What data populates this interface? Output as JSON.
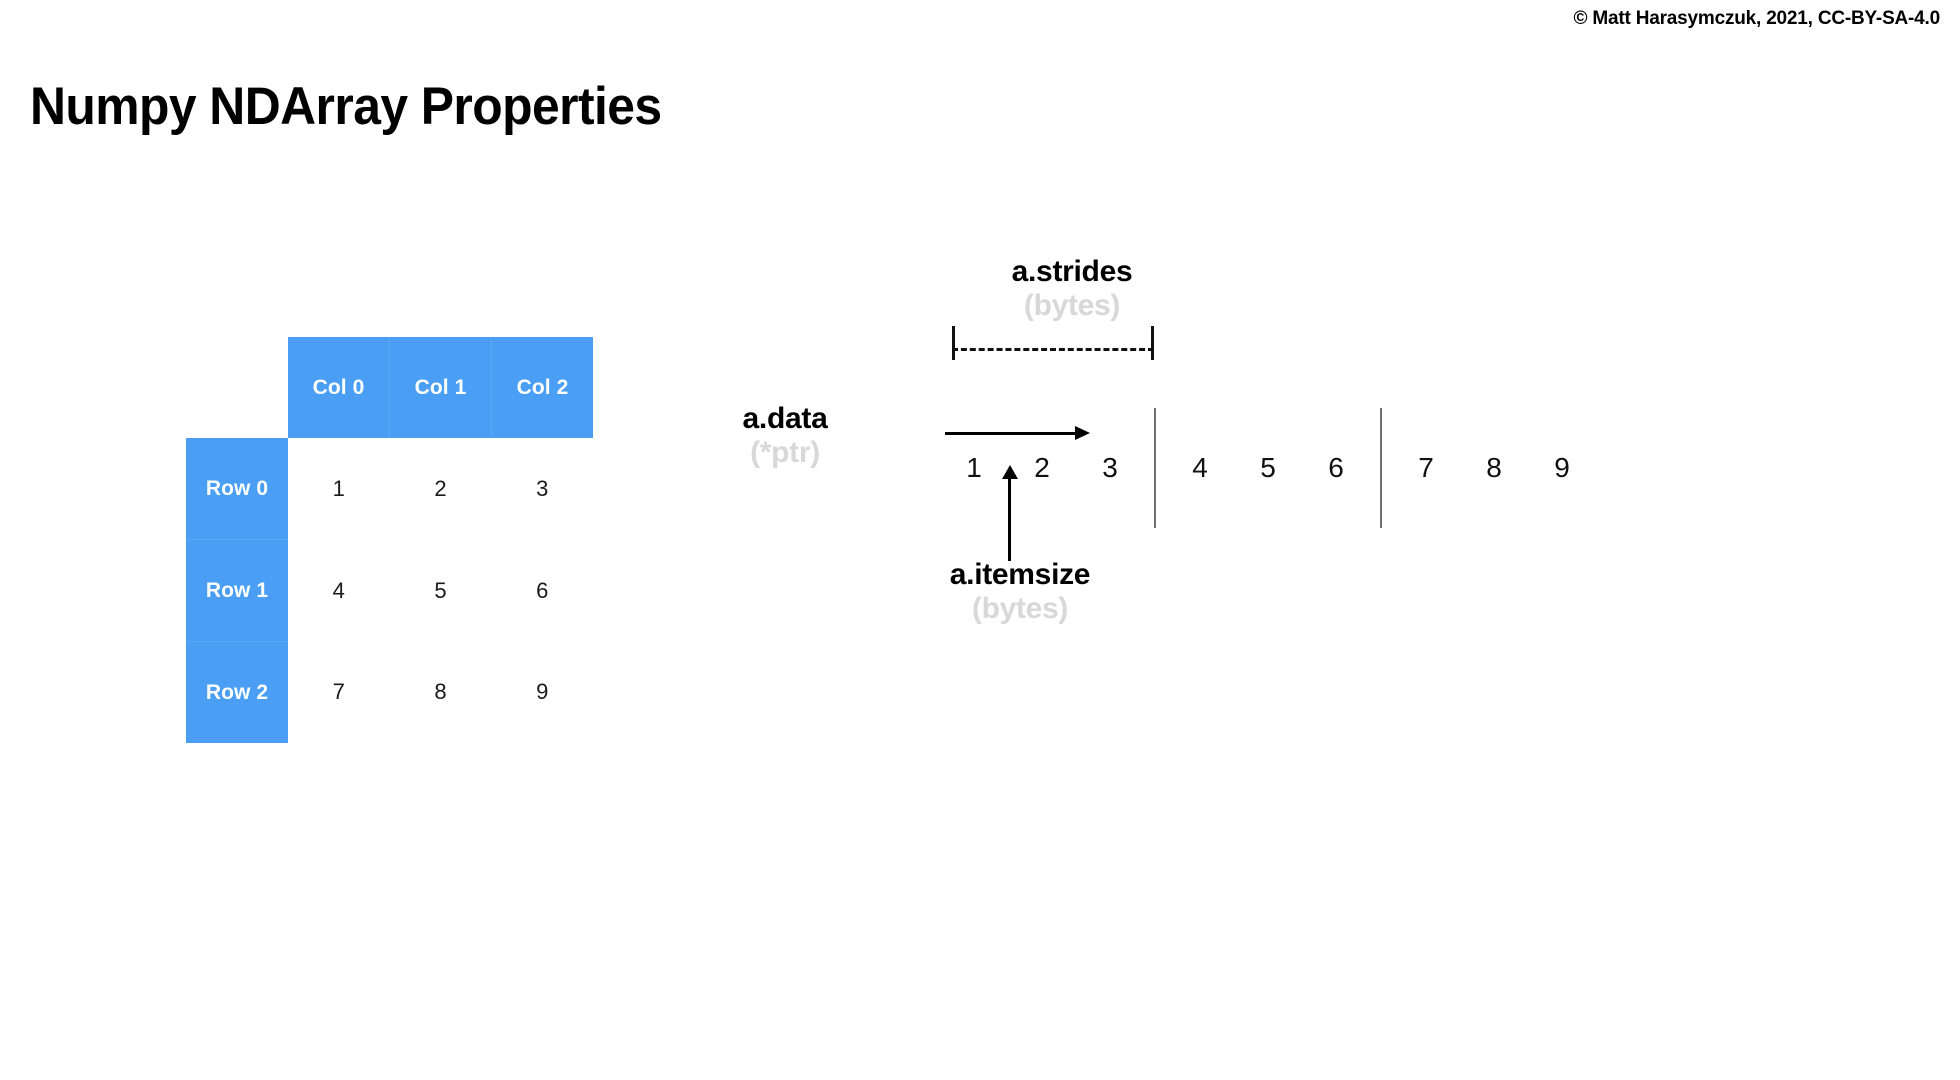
{
  "slide": {
    "title": "Numpy NDArray Properties",
    "copyright": "© Matt Harasymczuk, 2021, CC-BY-SA-4.0",
    "background_color": "#ffffff",
    "accent_color": "#4a9ff5",
    "muted_color": "#d8d8d8"
  },
  "table": {
    "corner_label": "",
    "column_headers": [
      "Col 0",
      "Col 1",
      "Col 2"
    ],
    "row_headers": [
      "Row 0",
      "Row 1",
      "Row 2"
    ],
    "rows": [
      [
        "1",
        "2",
        "3"
      ],
      [
        "4",
        "5",
        "6"
      ],
      [
        "7",
        "8",
        "9"
      ]
    ]
  },
  "diagram": {
    "strides": {
      "name": "a.strides",
      "unit": "(bytes)"
    },
    "data": {
      "name": "a.data",
      "unit": "(*ptr)"
    },
    "itemsize": {
      "name": "a.itemsize",
      "unit": "(bytes)"
    },
    "memory_groups": [
      [
        "1",
        "2",
        "3"
      ],
      [
        "4",
        "5",
        "6"
      ],
      [
        "7",
        "8",
        "9"
      ]
    ]
  }
}
